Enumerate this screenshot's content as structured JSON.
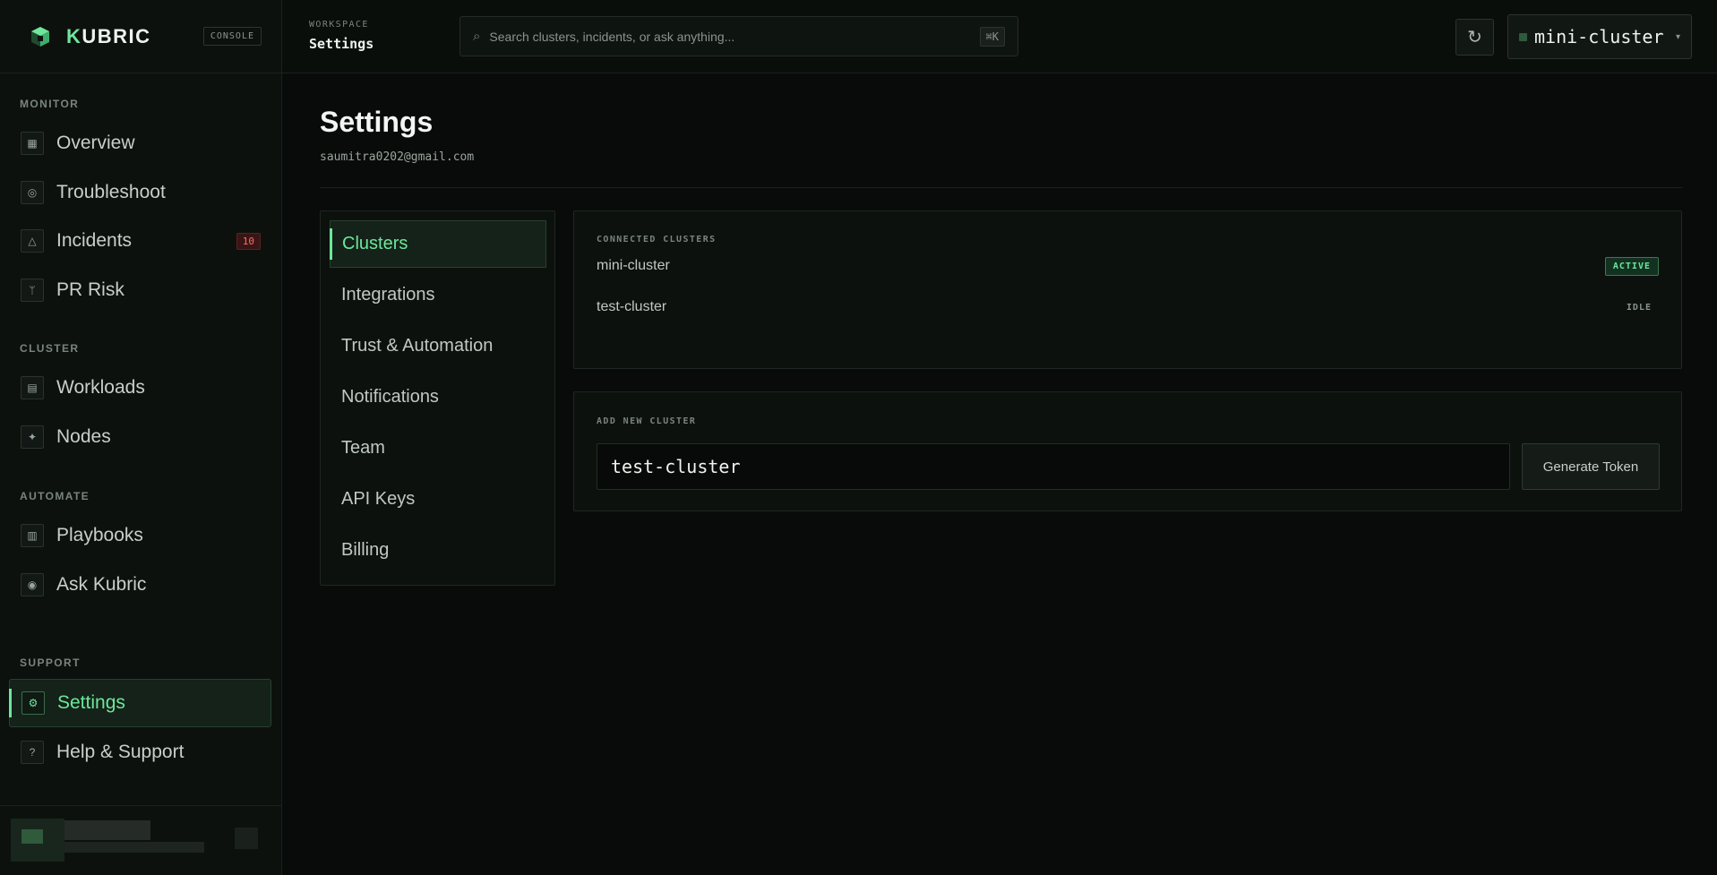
{
  "app": {
    "brand_prefix": "K",
    "brand_rest": "UBRIC",
    "console_badge": "CONSOLE"
  },
  "sidebar": {
    "sections": {
      "monitor": "MONITOR",
      "cluster": "CLUSTER",
      "automate": "AUTOMATE",
      "support": "SUPPORT"
    },
    "items": [
      {
        "label": "Overview",
        "icon": "grid-icon",
        "glyph": "▦"
      },
      {
        "label": "Troubleshoot",
        "icon": "target-icon",
        "glyph": "◎"
      },
      {
        "label": "Incidents",
        "icon": "warning-triangle-icon",
        "glyph": "△",
        "badge": "10"
      },
      {
        "label": "PR Risk",
        "icon": "branch-icon",
        "glyph": "ᛘ"
      },
      {
        "label": "Workloads",
        "icon": "list-icon",
        "glyph": "▤"
      },
      {
        "label": "Nodes",
        "icon": "sparkle-icon",
        "glyph": "✦"
      },
      {
        "label": "Playbooks",
        "icon": "book-icon",
        "glyph": "▥"
      },
      {
        "label": "Ask Kubric",
        "icon": "chat-dot-icon",
        "glyph": "◉"
      },
      {
        "label": "Settings",
        "icon": "gear-icon",
        "glyph": "⚙"
      },
      {
        "label": "Help & Support",
        "icon": "question-icon",
        "glyph": "?"
      }
    ]
  },
  "topbar": {
    "workspace_label": "WORKSPACE",
    "workspace_title": "Settings",
    "search_placeholder": "Search clusters, incidents, or ask anything...",
    "search_shortcut": "⌘K",
    "refresh_glyph": "↻",
    "cluster_selected": "mini-cluster",
    "caret_glyph": "▾"
  },
  "page": {
    "title": "Settings",
    "email": "saumitra0202@gmail.com"
  },
  "subnav": {
    "items": [
      "Clusters",
      "Integrations",
      "Trust & Automation",
      "Notifications",
      "Team",
      "API Keys",
      "Billing"
    ]
  },
  "connected": {
    "label": "CONNECTED CLUSTERS",
    "rows": [
      {
        "name": "mini-cluster",
        "status": "ACTIVE"
      },
      {
        "name": "test-cluster",
        "status": "IDLE"
      }
    ]
  },
  "add_cluster": {
    "label": "ADD NEW CLUSTER",
    "input_value": "test-cluster",
    "button_label": "Generate Token"
  },
  "colors": {
    "accent": "#6ee79b",
    "background": "#080b09",
    "badge_red": "#ff6b6b"
  }
}
